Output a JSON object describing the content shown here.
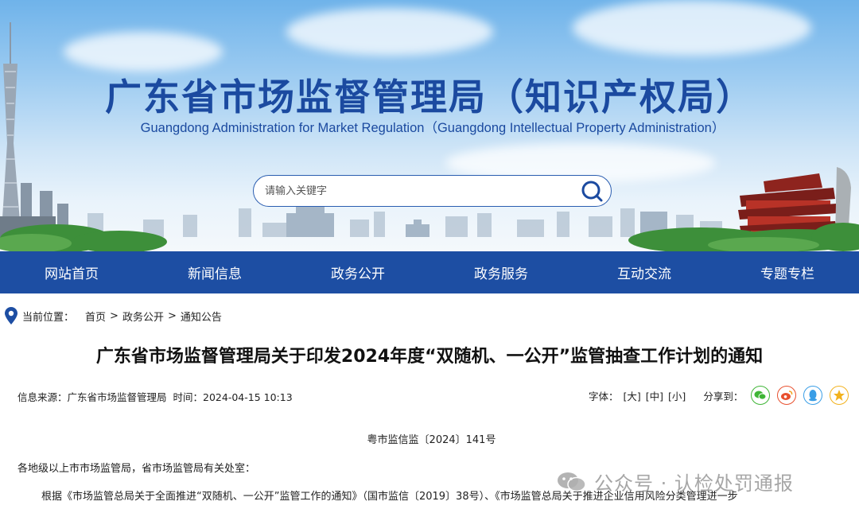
{
  "site": {
    "title": "广东省市场监督管理局（知识产权局）",
    "subtitle": "Guangdong Administration for Market Regulation（Guangdong Intellectual Property Administration）"
  },
  "search": {
    "placeholder": "请输入关键字"
  },
  "nav": {
    "items": [
      {
        "label": "网站首页"
      },
      {
        "label": "新闻信息"
      },
      {
        "label": "政务公开"
      },
      {
        "label": "政务服务"
      },
      {
        "label": "互动交流"
      },
      {
        "label": "专题专栏"
      }
    ]
  },
  "breadcrumb": {
    "prefix": "当前位置：",
    "items": [
      "首页",
      "政务公开",
      "通知公告"
    ],
    "separator": ">"
  },
  "article": {
    "title": "广东省市场监督管理局关于印发2024年度“双随机、一公开”监管抽查工作计划的通知",
    "source": "信息来源：广东省市场监督管理局",
    "time": "时间：2024-04-15 10:13",
    "font_label": "字体：",
    "font_sizes": [
      "[大]",
      "[中]",
      "[小]"
    ],
    "share_label": "分享到：",
    "doc_number": "粤市监信监〔2024〕141号",
    "paragraphs": [
      "各地级以上市市场监管局，省市场监管局有关处室：",
      "根据《市场监管总局关于全面推进“双随机、一公开”监管工作的通知》（国市监信〔2019〕38号）、《市场监管总局关于推进企业信用风险分类管理进一步"
    ]
  },
  "share_icons": [
    {
      "name": "wechat-icon",
      "color": "#3fb536"
    },
    {
      "name": "weibo-icon",
      "color": "#e8502e"
    },
    {
      "name": "qq-icon",
      "color": "#3a9ee6"
    },
    {
      "name": "qzone-icon",
      "color": "#f2b21e"
    }
  ],
  "watermark": {
    "text": "公众号 · 认检处罚通报"
  },
  "colors": {
    "brand": "#1d4ea3",
    "title_blue": "#1b4aa0"
  }
}
